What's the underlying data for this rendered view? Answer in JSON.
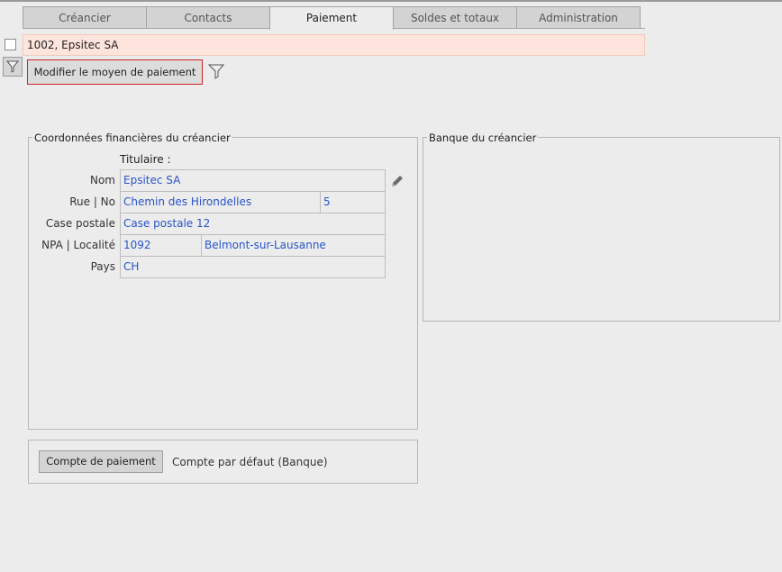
{
  "tabs": [
    "Créancier",
    "Contacts",
    "Paiement",
    "Soldes et totaux",
    "Administration"
  ],
  "record": {
    "title": "1002, Epsitec SA"
  },
  "toolbar": {
    "modify_label": "Modifier le moyen de paiement"
  },
  "financial": {
    "title": "Coordonnées financières du créancier",
    "holder_label": "Titulaire :",
    "name_label": "Nom",
    "name": "Epsitec SA",
    "street_label": "Rue | No",
    "street": "Chemin des Hirondelles",
    "number": "5",
    "box_label": "Case postale",
    "box": "Case postale 12",
    "city_label": "NPA | Localité",
    "zip": "1092",
    "city": "Belmont-sur-Lausanne",
    "country_label": "Pays",
    "country": "CH"
  },
  "bank": {
    "title": "Banque du créancier"
  },
  "payment": {
    "account_button": "Compte de paiement",
    "account_value": "Compte par défaut (Banque)"
  },
  "icons": {
    "filter": "filter-icon",
    "pencil": "pencil-icon"
  }
}
